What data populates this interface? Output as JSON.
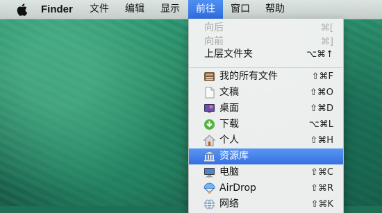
{
  "menubar": {
    "app_name": "Finder",
    "items": [
      "文件",
      "编辑",
      "显示",
      "前往",
      "窗口",
      "帮助"
    ],
    "active_item": "前往"
  },
  "go_menu": {
    "items": [
      {
        "label": "向后",
        "shortcut": "⌘[",
        "enabled": false
      },
      {
        "label": "向前",
        "shortcut": "⌘]",
        "enabled": false
      },
      {
        "label": "上层文件夹",
        "shortcut": "⌥⌘↑",
        "enabled": true
      },
      {
        "label": "我的所有文件",
        "shortcut": "⇧⌘F",
        "icon": "all-my-files-icon"
      },
      {
        "label": "文稿",
        "shortcut": "⇧⌘O",
        "icon": "document-icon"
      },
      {
        "label": "桌面",
        "shortcut": "⇧⌘D",
        "icon": "desktop-icon"
      },
      {
        "label": "下载",
        "shortcut": "⌥⌘L",
        "icon": "downloads-icon"
      },
      {
        "label": "个人",
        "shortcut": "⇧⌘H",
        "icon": "home-icon"
      },
      {
        "label": "资源库",
        "shortcut": "",
        "icon": "library-icon",
        "selected": true
      },
      {
        "label": "电脑",
        "shortcut": "⇧⌘C",
        "icon": "computer-icon"
      },
      {
        "label": "AirDrop",
        "shortcut": "⇧⌘R",
        "icon": "airdrop-icon"
      },
      {
        "label": "网络",
        "shortcut": "⇧⌘K",
        "icon": "network-icon"
      }
    ]
  },
  "colors": {
    "selection": "#3670e3",
    "disabled_text": "#a8a8a8"
  }
}
